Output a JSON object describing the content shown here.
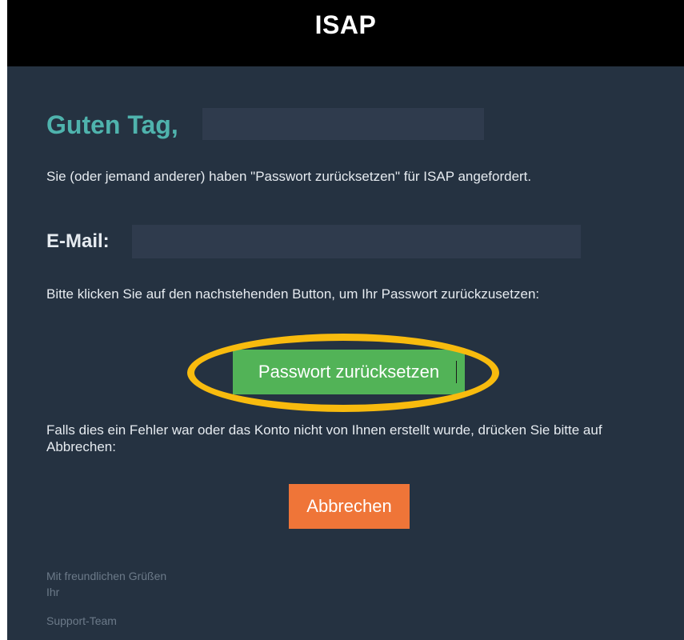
{
  "header": {
    "title": "ISAP"
  },
  "email": {
    "greeting": "Guten Tag,",
    "intro": "Sie (oder jemand anderer) haben \"Passwort zurücksetzen\" für ISAP angefordert.",
    "email_label": "E-Mail:",
    "instruction": "Bitte klicken Sie auf den nachstehenden Button, um Ihr Passwort zurückzusetzen:",
    "reset_button": "Passwort zurücksetzen",
    "cancel_instruction": "Falls dies ein Fehler war oder das Konto nicht von Ihnen erstellt wurde, drücken Sie bitte auf Abbrechen:",
    "cancel_button": "Abbrechen",
    "closing_line1": "Mit freundlichen Grüßen",
    "closing_line2": "Ihr",
    "signature": "Support-Team"
  },
  "colors": {
    "header_bg": "#000000",
    "body_bg": "#253241",
    "greeting": "#4fb3ad",
    "reset_button": "#52b357",
    "cancel_button": "#ef7538",
    "highlight_ring": "#f8bb0e",
    "redaction": "#2f3b4d"
  }
}
